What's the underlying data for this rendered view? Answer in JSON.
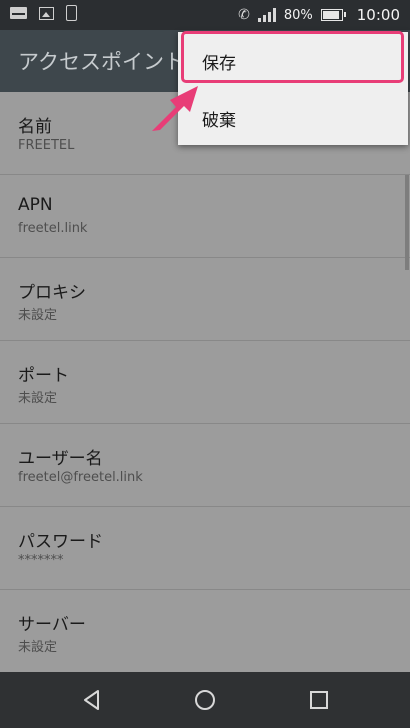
{
  "status_bar": {
    "battery": "80%",
    "time": "10:00"
  },
  "app_bar": {
    "title": "アクセスポイントの編集"
  },
  "fields": [
    {
      "label": "名前",
      "value": "FREETEL"
    },
    {
      "label": "APN",
      "value": "freetel.link"
    },
    {
      "label": "プロキシ",
      "value": "未設定"
    },
    {
      "label": "ポート",
      "value": "未設定"
    },
    {
      "label": "ユーザー名",
      "value": "freetel@freetel.link"
    },
    {
      "label": "パスワード",
      "value": "*******"
    },
    {
      "label": "サーバー",
      "value": "未設定"
    }
  ],
  "menu": {
    "save_label": "保存",
    "discard_label": "破棄"
  },
  "colors": {
    "highlight": "#e83d77",
    "app_bar": "#3e474c"
  }
}
